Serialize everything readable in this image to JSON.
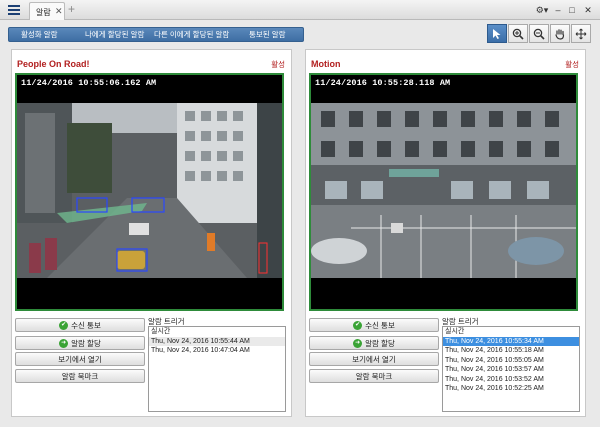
{
  "window": {
    "tab_label": "알람",
    "tab_close": "✕",
    "tab_add": "+",
    "controls": [
      "⚙▾",
      "–",
      "□",
      "✕"
    ]
  },
  "toolbar": {
    "alarm_tabs": [
      "활성화 알람",
      "나에게 할당된 알람",
      "다른 이에게 할당된 알람",
      "통보된 알람"
    ],
    "tools": [
      "pointer-icon",
      "zoom-in-icon",
      "zoom-out-icon",
      "hand-icon",
      "move-icon"
    ],
    "active_tool": 0,
    "accent_color": "#4a7bb0"
  },
  "panels": [
    {
      "title": "People On Road!",
      "status": "활성",
      "timestamp": "11/24/2016 10:55:06.162 AM",
      "buttons": [
        "수신 통보",
        "알람 할당",
        "보기에서 열기",
        "알람 북마크"
      ],
      "trigger_label": "알람 트리거",
      "triggers": [
        "실시간",
        "Thu, Nov 24, 2016 10:55:44 AM",
        "Thu, Nov 24, 2016 10:47:04 AM"
      ],
      "selected_trigger": -1,
      "hover_trigger": 1
    },
    {
      "title": "Motion",
      "status": "활성",
      "timestamp": "11/24/2016 10:55:28.118 AM",
      "buttons": [
        "수신 통보",
        "알람 할당",
        "보기에서 열기",
        "알람 북마크"
      ],
      "trigger_label": "알람 트리거",
      "triggers": [
        "실시간",
        "Thu, Nov 24, 2016 10:55:34 AM",
        "Thu, Nov 24, 2016 10:55:18 AM",
        "Thu, Nov 24, 2016 10:55:05 AM",
        "Thu, Nov 24, 2016 10:53:57 AM",
        "Thu, Nov 24, 2016 10:53:52 AM",
        "Thu, Nov 24, 2016 10:52:25 AM"
      ],
      "selected_trigger": 1,
      "hover_trigger": -1
    }
  ]
}
